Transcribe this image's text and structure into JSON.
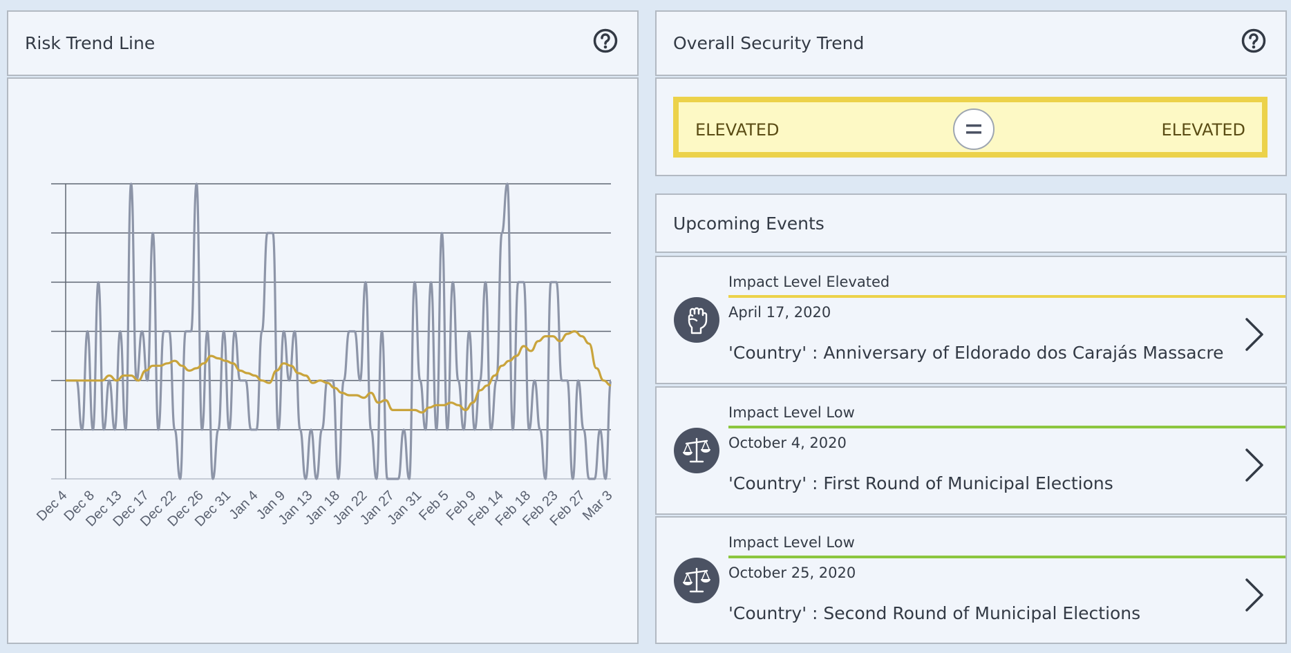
{
  "risk_panel": {
    "title": "Risk Trend Line",
    "help_icon": "question-circle-icon"
  },
  "security_panel": {
    "title": "Overall Security Trend",
    "help_icon": "question-circle-icon",
    "previous_level": "ELEVATED",
    "current_level": "ELEVATED",
    "trend_icon": "equals-icon",
    "colors": {
      "elevated_fill": "#fdf9c5",
      "elevated_border": "#ecd24a"
    }
  },
  "events_panel": {
    "title": "Upcoming Events",
    "items": [
      {
        "impact": "Impact Level Elevated",
        "impact_color": "#ecd24a",
        "date": "April 17, 2020",
        "title": "'Country' : Anniversary of Eldorado dos Carajás Massacre",
        "icon": "raised-fist-icon"
      },
      {
        "impact": "Impact Level Low",
        "impact_color": "#8cc63f",
        "date": "October 4, 2020",
        "title": "'Country' : First Round of Municipal Elections",
        "icon": "scales-icon"
      },
      {
        "impact": "Impact Level Low",
        "impact_color": "#8cc63f",
        "date": "October 25, 2020",
        "title": "'Country' : Second Round of Municipal Elections",
        "icon": "scales-icon"
      }
    ]
  },
  "chart_data": {
    "type": "line",
    "title": "",
    "xlabel": "",
    "ylabel": "",
    "ylim": [
      0,
      6
    ],
    "grid": true,
    "tick_labels": [
      "Dec 4",
      "Dec 8",
      "Dec 13",
      "Dec 17",
      "Dec 22",
      "Dec 26",
      "Dec 31",
      "Jan 4",
      "Jan 9",
      "Jan 13",
      "Jan 18",
      "Jan 22",
      "Jan 27",
      "Jan 31",
      "Feb 5",
      "Feb 9",
      "Feb 14",
      "Feb 18",
      "Feb 23",
      "Feb 27",
      "Mar 3"
    ],
    "series": [
      {
        "color": "#8d95a8",
        "values": [
          2,
          2,
          2,
          1,
          3,
          1,
          4,
          1,
          2,
          1,
          3,
          1,
          6,
          2,
          3,
          2,
          5,
          1,
          3,
          3,
          1,
          0,
          3,
          3,
          6,
          1,
          3,
          0,
          1,
          3,
          1,
          3,
          2,
          2,
          1,
          1,
          3,
          5,
          5,
          1,
          3,
          2,
          3,
          1,
          0,
          1,
          0,
          1,
          2,
          2,
          0,
          2,
          3,
          3,
          2,
          4,
          1,
          0,
          3,
          0,
          0,
          0,
          1,
          0,
          4,
          2,
          1,
          4,
          1,
          5,
          1,
          4,
          2,
          1,
          3,
          1,
          2,
          4,
          1,
          2,
          5,
          6,
          1,
          4,
          4,
          1,
          2,
          1,
          0,
          4,
          4,
          2,
          2,
          0,
          2,
          1,
          0,
          0,
          1,
          0,
          2
        ]
      },
      {
        "color": "#c9a43c",
        "values": [
          2,
          2,
          2,
          2,
          2,
          2,
          2.1,
          2,
          2.1,
          2.1,
          2,
          2.2,
          2.3,
          2.3,
          2.35,
          2.4,
          2.3,
          2.2,
          2.25,
          2.35,
          2.5,
          2.45,
          2.4,
          2.35,
          2.2,
          2.15,
          2.1,
          2,
          1.95,
          2.2,
          2.35,
          2.3,
          2.15,
          2.1,
          1.95,
          2,
          1.95,
          1.85,
          1.75,
          1.7,
          1.7,
          1.65,
          1.75,
          1.55,
          1.6,
          1.4,
          1.4,
          1.4,
          1.4,
          1.35,
          1.45,
          1.5,
          1.5,
          1.55,
          1.5,
          1.4,
          1.55,
          1.8,
          1.9,
          2.1,
          2.3,
          2.4,
          2.5,
          2.7,
          2.6,
          2.8,
          2.9,
          2.9,
          2.8,
          2.95,
          3,
          2.9,
          2.75,
          2.25,
          2.0,
          1.9
        ]
      }
    ]
  }
}
